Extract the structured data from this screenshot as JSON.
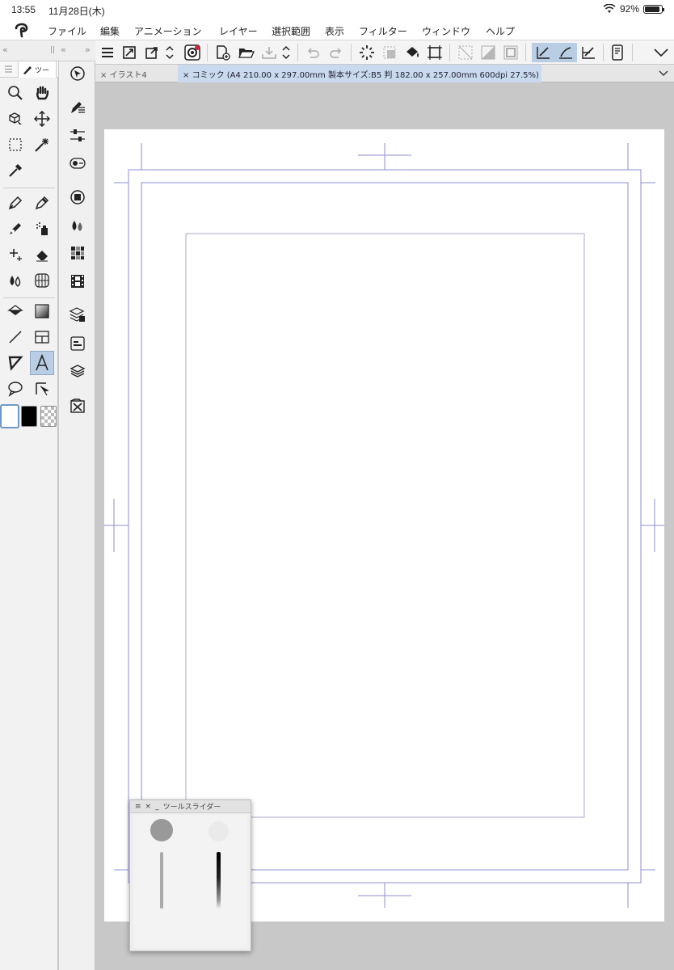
{
  "status": {
    "time": "13:55",
    "date": "11月28日(木)",
    "battery": "92%",
    "battery_level": 0.92
  },
  "menu": {
    "items": [
      "ファイル",
      "編集",
      "アニメーション",
      "レイヤー",
      "選択範囲",
      "表示",
      "フィルター",
      "ウィンドウ",
      "ヘルプ"
    ]
  },
  "panel_strip": {
    "left_collapse": "«",
    "grip": "||",
    "right_collapse": "«",
    "right_expand": "»"
  },
  "tool_panel": {
    "tab_label": "ツー"
  },
  "tabs": [
    {
      "label": "イラスト4",
      "close": "×",
      "active": false
    },
    {
      "label": "コミック (A4 210.00 x 297.00mm 製本サイズ:B5 判 182.00 x 257.00mm 600dpi 27.5%)",
      "close": "×",
      "active": true
    }
  ],
  "tool_slider": {
    "title": "ツールスライダー",
    "close": "×",
    "minimize": "_",
    "menu": "≡"
  },
  "colors": {
    "accent": "#b9cde4",
    "guide": "#8c8cd0",
    "frame": "#a9a9c9"
  }
}
